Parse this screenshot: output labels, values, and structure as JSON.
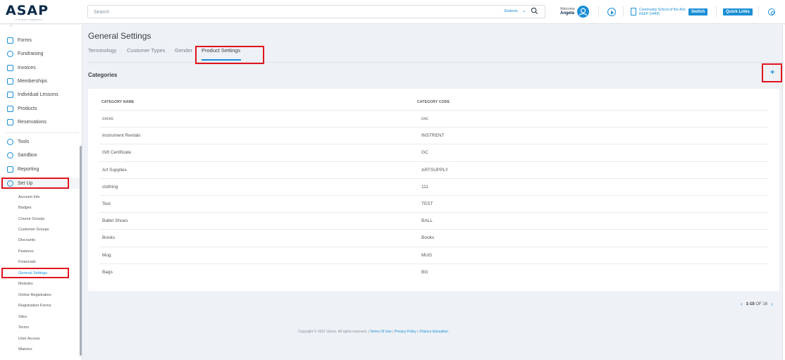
{
  "header": {
    "logo": "ASAP",
    "logo_sub": "A VANCO COMPANY",
    "search_placeholder": "Search",
    "search_scope": "Students",
    "welcome_label": "Welcome",
    "user_name": "Angela",
    "school_name": "Community School of the Arts KEEP (3449)",
    "switch_label": "Switch",
    "quick_links_label": "Quick Links"
  },
  "sidebar": {
    "items": [
      {
        "label": "Forms"
      },
      {
        "label": "Fundraising"
      },
      {
        "label": "Invoices"
      },
      {
        "label": "Memberships"
      },
      {
        "label": "Individual Lessons"
      },
      {
        "label": "Products"
      },
      {
        "label": "Reservations"
      },
      {
        "label": "Tools"
      },
      {
        "label": "Sandbox"
      },
      {
        "label": "Reporting"
      },
      {
        "label": "Set Up"
      }
    ],
    "subitems": [
      "Account Info",
      "Badges",
      "Course Groups",
      "Customer Groups",
      "Discounts",
      "Features",
      "Financials",
      "General Settings",
      "Modules",
      "Online Registration",
      "Registration Forms",
      "Sites",
      "Terms",
      "User Access",
      "Waivers"
    ]
  },
  "main": {
    "title": "General Settings",
    "tabs": [
      {
        "label": "Terminology"
      },
      {
        "label": "Customer Types"
      },
      {
        "label": "Gender"
      },
      {
        "label": "Product Settings"
      }
    ],
    "section_title": "Categories",
    "add_symbol": "+",
    "table": {
      "headers": [
        "CATEGORY NAME",
        "CATEGORY CODE"
      ],
      "rows": [
        {
          "name": "cxcxc",
          "code": "cxc"
        },
        {
          "name": "Instrument Rentals",
          "code": "INSTRENT"
        },
        {
          "name": "Gift Certificate",
          "code": "GC"
        },
        {
          "name": "Art Supplies",
          "code": "ARTSUPPLY"
        },
        {
          "name": "clothing",
          "code": "111"
        },
        {
          "name": "Test",
          "code": "TEST"
        },
        {
          "name": "Ballet Shoes",
          "code": "BALL"
        },
        {
          "name": "Books",
          "code": "Books"
        },
        {
          "name": "Mug",
          "code": "MUG"
        },
        {
          "name": "Bags",
          "code": "BG"
        }
      ]
    },
    "pager": {
      "range": "1-10",
      "of_label": "OF 16"
    }
  },
  "footer": {
    "copyright": "Copyright © 2021 Vanco. All rights reserved. |",
    "terms": "Terms Of Use",
    "sep": "|",
    "privacy": "Privacy Policy",
    "sep2": "|",
    "vanco": "©Vanco Education"
  },
  "colors": {
    "accent": "#1a8fd6",
    "highlight": "#e0141e"
  }
}
